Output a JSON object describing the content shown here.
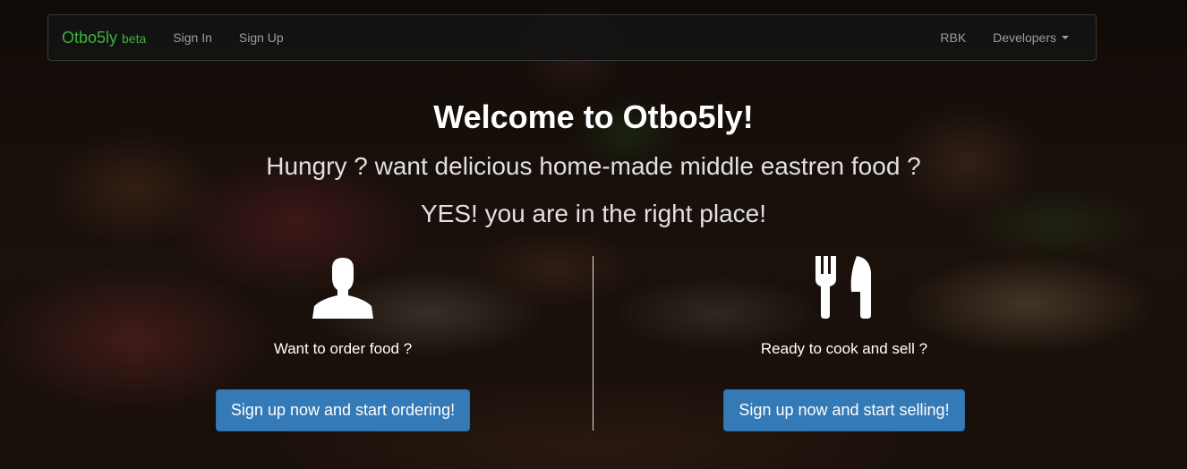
{
  "navbar": {
    "brand": "Otbo5ly",
    "brand_suffix": "beta",
    "left_links": [
      "Sign In",
      "Sign Up"
    ],
    "right_links": [
      "RBK"
    ],
    "dropdown_label": "Developers"
  },
  "hero": {
    "title": "Welcome to Otbo5ly!",
    "subtitle": "Hungry ? want delicious home-made middle eastren food ?",
    "subtitle2": "YES! you are in the right place!"
  },
  "order": {
    "icon": "user-icon",
    "text": "Want to order food ?",
    "button": "Sign up now and start ordering!"
  },
  "sell": {
    "icon": "cutlery-icon",
    "text": "Ready to cook and sell ?",
    "button": "Sign up now and start selling!"
  },
  "colors": {
    "brand": "#3cb13c",
    "navbar_bg": "#141414",
    "button": "#337ab7"
  }
}
